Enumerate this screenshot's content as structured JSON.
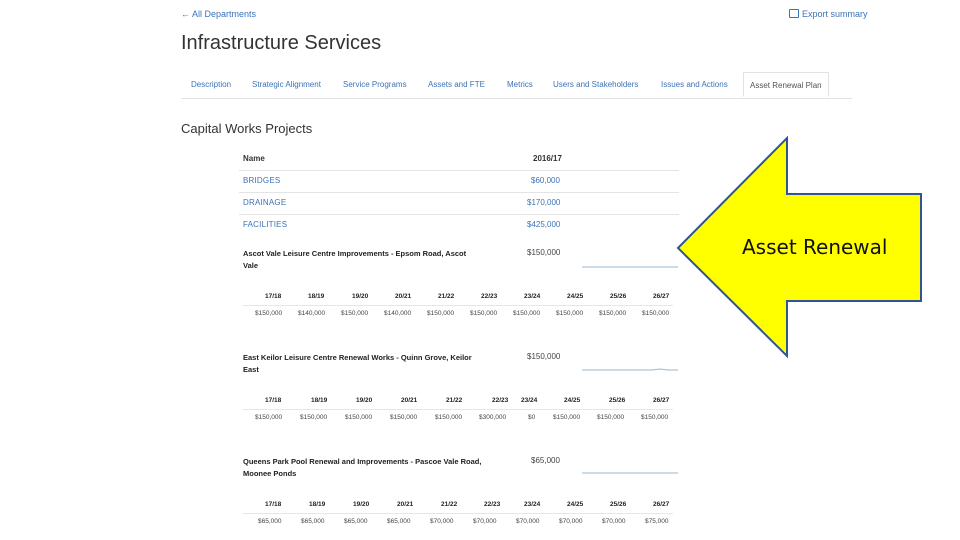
{
  "nav": {
    "back_label": "← All Departments",
    "export_label": "Export summary"
  },
  "page": {
    "title": "Infrastructure Services"
  },
  "tabs": [
    {
      "label": "Description"
    },
    {
      "label": "Strategic Alignment"
    },
    {
      "label": "Service Programs"
    },
    {
      "label": "Assets and FTE"
    },
    {
      "label": "Metrics"
    },
    {
      "label": "Users and Stakeholders"
    },
    {
      "label": "Issues and Actions"
    },
    {
      "label": "Asset Renewal Plan",
      "active": true
    }
  ],
  "section": {
    "title": "Capital Works Projects"
  },
  "table": {
    "headers": {
      "name": "Name",
      "year": "2016/17"
    },
    "categories": [
      {
        "name": "BRIDGES",
        "amount": "$60,000"
      },
      {
        "name": "DRAINAGE",
        "amount": "$170,000"
      },
      {
        "name": "FACILITIES",
        "amount": "$425,000"
      }
    ]
  },
  "projects": [
    {
      "name": "Ascot Vale Leisure Centre Improvements - Epsom Road, Ascot Vale",
      "total": "$150,000",
      "years": [
        "17/18",
        "18/19",
        "19/20",
        "20/21",
        "21/22",
        "22/23",
        "23/24",
        "24/25",
        "25/26",
        "26/27"
      ],
      "values": [
        "$150,000",
        "$140,000",
        "$150,000",
        "$140,000",
        "$150,000",
        "$150,000",
        "$150,000",
        "$150,000",
        "$150,000",
        "$150,000"
      ]
    },
    {
      "name": "East Keilor Leisure Centre Renewal Works - Quinn Grove, Keilor East",
      "total": "$150,000",
      "years": [
        "17/18",
        "18/19",
        "19/20",
        "20/21",
        "21/22",
        "22/23",
        "23/24",
        "24/25",
        "25/26",
        "26/27"
      ],
      "values": [
        "$150,000",
        "$150,000",
        "$150,000",
        "$150,000",
        "$150,000",
        "$300,000",
        "$0",
        "$150,000",
        "$150,000",
        "$150,000"
      ]
    },
    {
      "name": "Queens Park Pool Renewal and Improvements - Pascoe Vale Road, Moonee Ponds",
      "total": "$65,000",
      "years": [
        "17/18",
        "18/19",
        "19/20",
        "20/21",
        "21/22",
        "22/23",
        "23/24",
        "24/25",
        "25/26",
        "26/27"
      ],
      "values": [
        "$65,000",
        "$65,000",
        "$65,000",
        "$65,000",
        "$70,000",
        "$70,000",
        "$70,000",
        "$70,000",
        "$70,000",
        "$75,000"
      ]
    }
  ],
  "annotation": {
    "label": "Asset Renewal"
  },
  "colors": {
    "link": "#3b73b9",
    "arrow_fill": "#ffff00",
    "arrow_stroke": "#2f5597"
  }
}
